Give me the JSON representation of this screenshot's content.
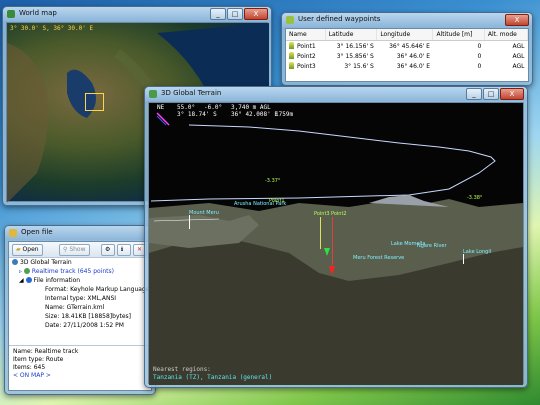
{
  "world_map": {
    "title": "World map",
    "coordinates": "3° 30.0' S, 36° 30.0' E",
    "maximize_label": "⛶"
  },
  "waypoints": {
    "title": "User defined waypoints",
    "columns": [
      "Name",
      "Latitude",
      "Longitude",
      "Altitude [m]",
      "Alt. mode"
    ],
    "rows": [
      {
        "name": "Point1",
        "lat": "3° 16.156' S",
        "lon": "36° 45.646' E",
        "alt": "0",
        "mode": "AGL"
      },
      {
        "name": "Point2",
        "lat": "3° 15.856' S",
        "lon": "36° 46.0' E",
        "alt": "0",
        "mode": "AGL"
      },
      {
        "name": "Point3",
        "lat": "3° 15.6' S",
        "lon": "36° 46.0' E",
        "alt": "0",
        "mode": "AGL"
      }
    ]
  },
  "terrain": {
    "title": "3D Global Terrain",
    "hud": {
      "heading": "NE",
      "pitch": "55.0°",
      "roll": "-6.0°",
      "alt": "3,740 m AGL",
      "lat": "3° 18.74' S",
      "lon": "36° 42.008' E",
      "range": "1759m"
    },
    "labels": {
      "lat_north": "-3.37°",
      "lat_east": "-3.38°",
      "mount_meru": "Mount Meru",
      "arusha": "Arusha National Park",
      "point_a": "Point1",
      "point_b": "Point3",
      "point_c": "Point2",
      "lake_momella": "Lake Momella",
      "ngare_river": "Ngare River",
      "lake_longil": "Lake Longil",
      "meru_forest": "Meru Forest Reserve"
    },
    "nearest_label": "Nearest regions:",
    "nearest_value": "Tanzania (TZ), Tanzania (general)"
  },
  "open_file": {
    "title": "Open file",
    "buttons": {
      "open": "Open",
      "show": "Show"
    },
    "tree": {
      "root": "3D Global Terrain",
      "track": "Realtime track (645 points)",
      "file_info": "File information",
      "format": "Format: Keyhole Markup Language",
      "internal": "Internal type: XML,ANSI",
      "name": "Name: GTerrain.kml",
      "size": "Size: 18.41KB [18858]bytes]",
      "date": "Date: 27/11/2008 1:52 PM"
    },
    "info": {
      "name": "Name: Realtime track",
      "type": "Item type: Route",
      "items": "Items: 645",
      "link": "< ON MAP >"
    }
  }
}
